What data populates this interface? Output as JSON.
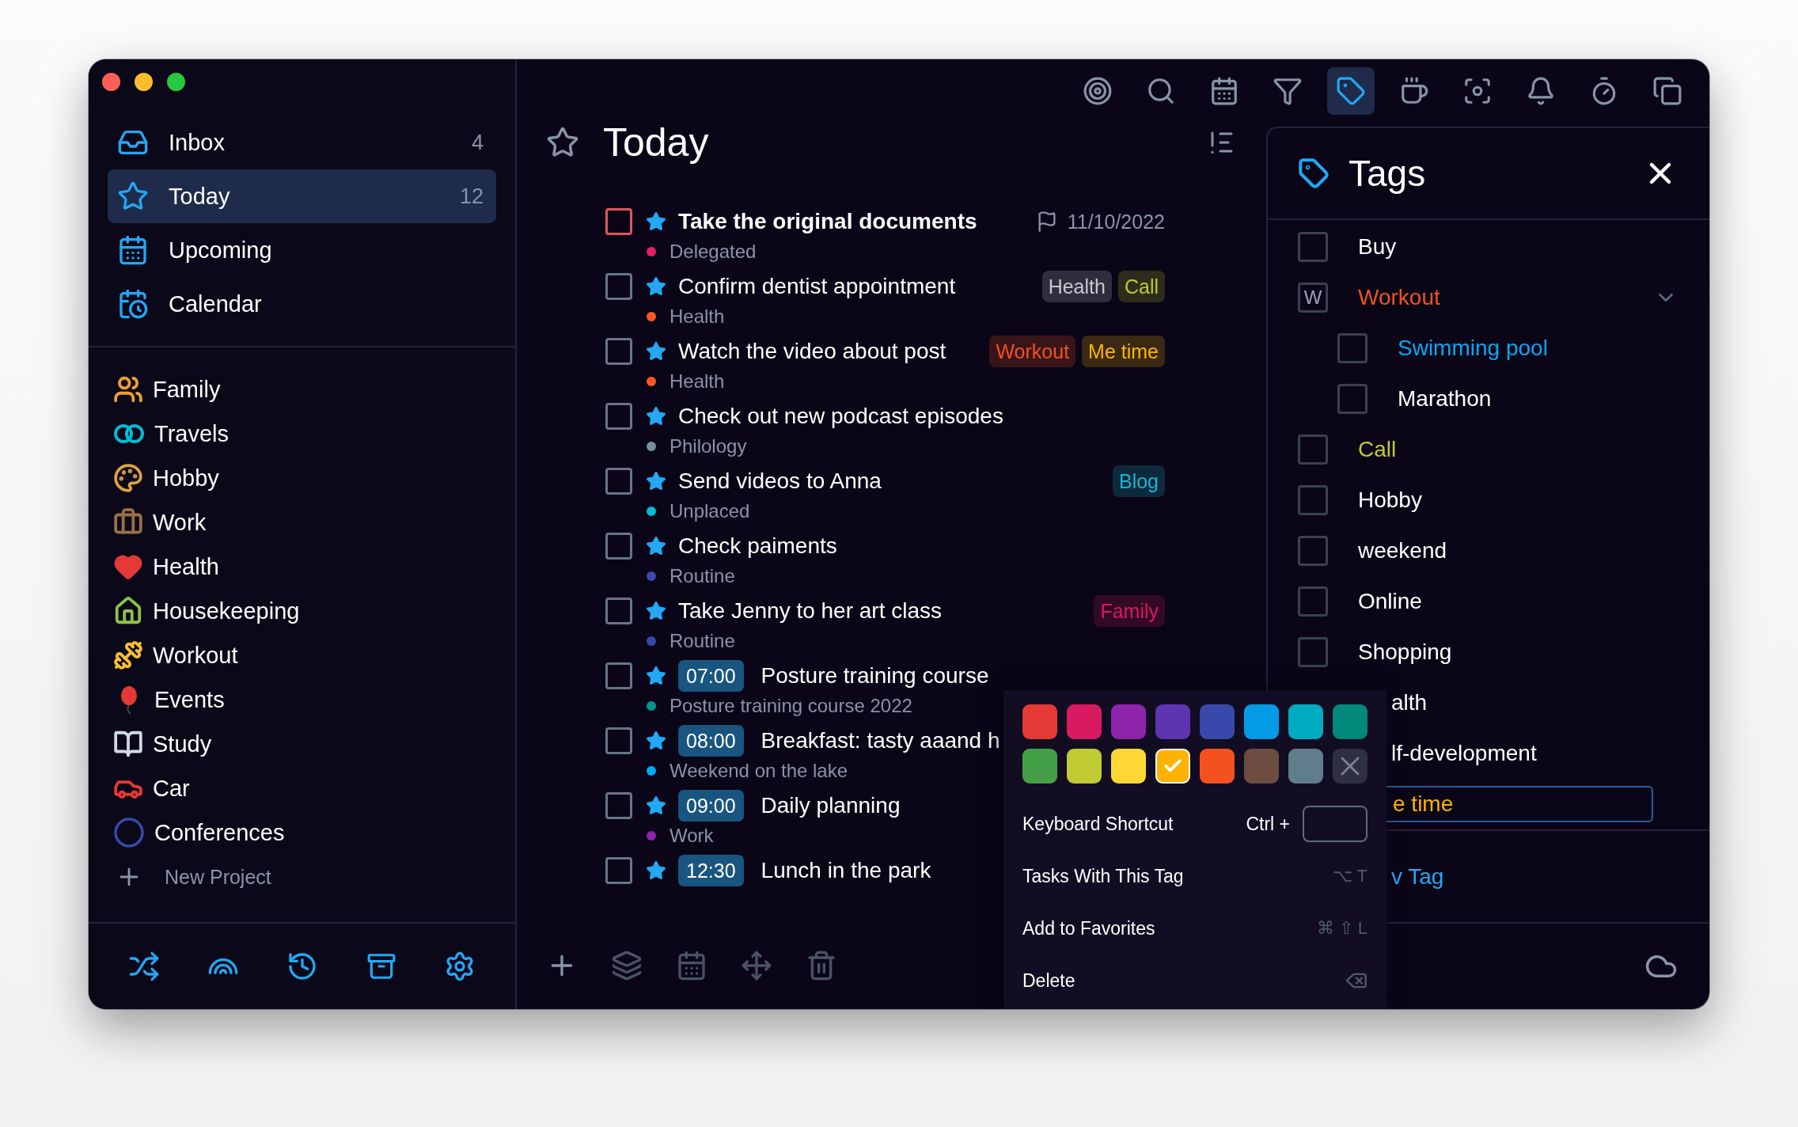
{
  "sidebar": {
    "nav": [
      {
        "label": "Inbox",
        "count": "4",
        "selected": false
      },
      {
        "label": "Today",
        "count": "12",
        "selected": true
      },
      {
        "label": "Upcoming",
        "selected": false
      },
      {
        "label": "Calendar",
        "selected": false
      }
    ],
    "projects": [
      "Family",
      "Travels",
      "Hobby",
      "Work",
      "Health",
      "Housekeeping",
      "Workout",
      "Events",
      "Study",
      "Car",
      "Conferences"
    ],
    "new_project": "New Project"
  },
  "toolbar": [
    {
      "selected": false
    },
    {
      "selected": false
    },
    {
      "selected": false
    },
    {
      "selected": false
    },
    {
      "selected": true
    },
    {
      "selected": false
    },
    {
      "selected": false
    },
    {
      "selected": false
    },
    {
      "selected": false
    },
    {
      "selected": false
    }
  ],
  "header": {
    "title": "Today"
  },
  "tasks": [
    {
      "title": "Take the original documents",
      "urgent": true,
      "checked": false,
      "project": "Delegated",
      "color": "#e91e63",
      "due": "11/10/2022"
    },
    {
      "title": "Confirm dentist appointment",
      "urgent": false,
      "checked": false,
      "project": "Health",
      "color": "#ff5722",
      "tags": [
        {
          "label": "Health",
          "color": "#302d3d"
        },
        {
          "label": "Call",
          "color": "#2e2d1d"
        }
      ]
    },
    {
      "title": "Watch the video about post",
      "urgent": false,
      "checked": false,
      "project": "Health",
      "color": "#ff5722",
      "tags": [
        {
          "label": "Workout",
          "color": "#391519"
        },
        {
          "label": "Me time",
          "color": "#3b2913"
        }
      ]
    },
    {
      "title": "Check out new podcast episodes",
      "urgent": false,
      "checked": false,
      "project": "Philology",
      "color": "#78909c"
    },
    {
      "title": "Send videos to Anna",
      "urgent": false,
      "checked": false,
      "project": "Unplaced",
      "color": "#00bcd4",
      "tags": [
        {
          "label": "Blog",
          "color": "#0d293c"
        }
      ]
    },
    {
      "title": "Check paiments",
      "urgent": false,
      "checked": false,
      "project": "Routine",
      "color": "#3949ab"
    },
    {
      "title": "Take Jenny to her art class",
      "urgent": false,
      "checked": false,
      "project": "Routine",
      "color": "#3949ab",
      "tags": [
        {
          "label": "Family",
          "color": "#330a26"
        }
      ]
    },
    {
      "title": "Posture training course",
      "urgent": false,
      "checked": false,
      "time": "07:00",
      "project": "Posture training course 2022",
      "color": "#009688"
    },
    {
      "title": "Breakfast: tasty aaand h",
      "urgent": false,
      "checked": false,
      "time": "08:00",
      "project": "Weekend on the lake",
      "color": "#03a9f4"
    },
    {
      "title": "Daily planning",
      "urgent": false,
      "checked": false,
      "time": "09:00",
      "project": "Work",
      "color": "#8e24aa"
    },
    {
      "title": "Lunch in the park",
      "urgent": false,
      "checked": false,
      "time": "12:30"
    }
  ],
  "tags_panel": {
    "title": "Tags",
    "items": [
      {
        "kind": "tag",
        "label": "Buy",
        "color": "#ffffff",
        "checked": false
      },
      {
        "kind": "tag",
        "label": "Workout",
        "color": "#f4511e",
        "shortcut": "W",
        "expanded": true,
        "children": [
          {
            "kind": "tag",
            "label": "Swimming pool",
            "color": "#03a9f4",
            "checked": false
          },
          {
            "kind": "tag",
            "label": "Marathon",
            "color": "#ffffff",
            "checked": false
          }
        ]
      },
      {
        "kind": "tag",
        "label": "Call",
        "color": "#c0ca33",
        "checked": false
      },
      {
        "kind": "tag",
        "label": "Hobby",
        "color": "#ffffff",
        "checked": false
      },
      {
        "kind": "tag",
        "label": "weekend",
        "color": "#ffffff",
        "checked": false
      },
      {
        "kind": "tag",
        "label": "Online",
        "color": "#ffffff",
        "checked": false
      },
      {
        "kind": "tag",
        "label": "Shopping",
        "color": "#ffffff",
        "checked": false
      },
      {
        "kind": "partial",
        "label": "alth",
        "color": "#ffffff"
      },
      {
        "kind": "partial",
        "label": "lf-development",
        "color": "#ffffff"
      },
      {
        "kind": "editing",
        "label": "e time",
        "color": "#ffb300"
      }
    ],
    "new_tag": "v Tag"
  },
  "tag_menu": {
    "swatches": [
      {
        "kind": "color",
        "color": "#e53935",
        "selected": false
      },
      {
        "kind": "color",
        "color": "#d81b60",
        "selected": false
      },
      {
        "kind": "color",
        "color": "#8e24aa",
        "selected": false
      },
      {
        "kind": "color",
        "color": "#5e35b1",
        "selected": false
      },
      {
        "kind": "color",
        "color": "#3949ab",
        "selected": false
      },
      {
        "kind": "color",
        "color": "#039be5",
        "selected": false
      },
      {
        "kind": "color",
        "color": "#00acc1",
        "selected": false
      },
      {
        "kind": "color",
        "color": "#00897b",
        "selected": false
      },
      {
        "kind": "color",
        "color": "#43a047",
        "selected": false
      },
      {
        "kind": "color",
        "color": "#c0ca33",
        "selected": false
      },
      {
        "kind": "color",
        "color": "#fdd835",
        "selected": false
      },
      {
        "kind": "color",
        "color": "#ffb300",
        "selected": true
      },
      {
        "kind": "color",
        "color": "#f4511e",
        "selected": false
      },
      {
        "kind": "color",
        "color": "#6d4c41",
        "selected": false
      },
      {
        "kind": "color",
        "color": "#607d8b",
        "selected": false
      },
      {
        "kind": "none",
        "selected": false
      }
    ],
    "items": [
      {
        "kind": "shortcut",
        "label": "Keyboard Shortcut",
        "prefix": "Ctrl +"
      },
      {
        "kind": "command",
        "label": "Tasks With This Tag",
        "keys": "⌥ T"
      },
      {
        "kind": "command",
        "label": "Add to Favorites",
        "keys": "⌘ ⇧ L"
      },
      {
        "kind": "delete",
        "label": "Delete"
      }
    ]
  }
}
